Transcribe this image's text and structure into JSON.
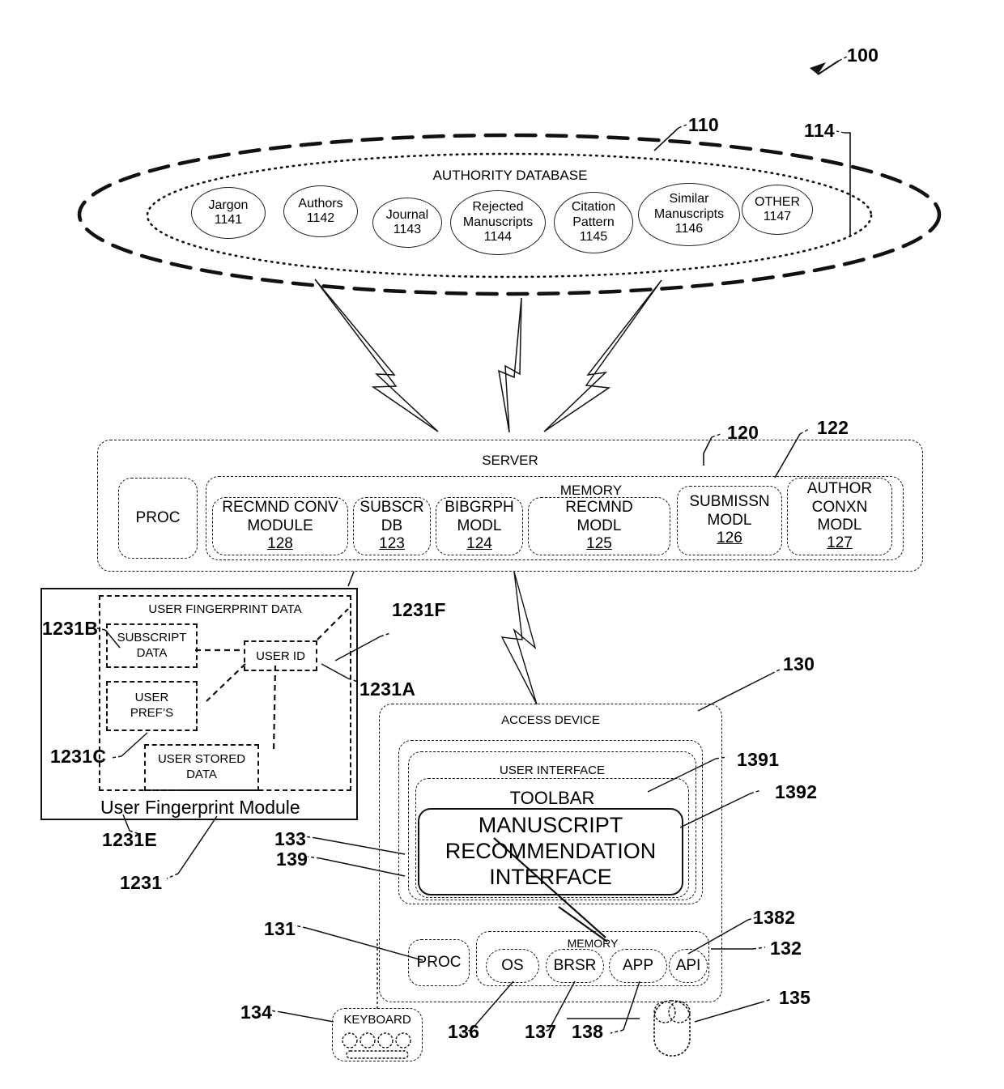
{
  "figure": {
    "system_ref": "100",
    "authority_database": {
      "title": "AUTHORITY DATABASE",
      "outer_ref": "110",
      "group_ref": "114",
      "nodes": [
        {
          "label": "Jargon",
          "ref": "1141"
        },
        {
          "label": "Authors",
          "ref": "1142"
        },
        {
          "label": "Journal",
          "ref": "1143"
        },
        {
          "label": "Rejected\nManuscripts",
          "ref": "1144"
        },
        {
          "label": "Citation\nPattern",
          "ref": "1145"
        },
        {
          "label": "Similar\nManuscripts",
          "ref": "1146"
        },
        {
          "label": "OTHER",
          "ref": "1147"
        }
      ]
    },
    "server": {
      "title": "SERVER",
      "ref": "120",
      "memory_label": "MEMORY",
      "memory_ref": "122",
      "proc_label": "PROC",
      "modules": [
        {
          "lines": [
            "RECMND CONV",
            "MODULE"
          ],
          "ref": "128"
        },
        {
          "lines": [
            "SUBSCR",
            "DB"
          ],
          "ref": "123"
        },
        {
          "lines": [
            "BIBGRPH",
            "MODL"
          ],
          "ref": "124"
        },
        {
          "lines": [
            "RECMND",
            "MODL"
          ],
          "ref": "125"
        },
        {
          "lines": [
            "SUBMISSN",
            "MODL"
          ],
          "ref": "126"
        },
        {
          "lines": [
            "AUTHOR",
            "CONXN",
            "MODL"
          ],
          "ref": "127"
        }
      ]
    },
    "fingerprint_module": {
      "module_title": "User Fingerprint Module",
      "module_ref": "1231",
      "data_title": "USER FINGERPRINT DATA",
      "data_ref": "1231E",
      "items": [
        {
          "lines": [
            "SUBSCRIPT",
            "DATA"
          ],
          "ref": "1231B"
        },
        {
          "lines": [
            "USER",
            "PREF’S"
          ],
          "ref": "1231C"
        },
        {
          "lines": [
            "USER STORED",
            "DATA"
          ],
          "ref": "1231A"
        },
        {
          "lines": [
            "USER ID"
          ],
          "ref": "1231F"
        }
      ]
    },
    "access_device": {
      "title": "ACCESS DEVICE",
      "ref": "130",
      "user_interface_label": "USER INTERFACE",
      "user_interface_ref": "1391",
      "toolbar_label": "TOOLBAR",
      "toolbar_ref": "1392",
      "interface_lines": [
        "MANUSCRIPT",
        "RECOMMENDATION",
        "INTERFACE"
      ],
      "interface_ref_a": "133",
      "interface_ref_b": "139",
      "proc_label": "PROC",
      "proc_ref": "131",
      "memory_label": "MEMORY",
      "memory_ref": "132",
      "api_ref": "1382",
      "apps": [
        {
          "label": "OS",
          "ref": "136"
        },
        {
          "label": "BRSR",
          "ref": "137"
        },
        {
          "label": "APP",
          "ref": "138"
        },
        {
          "label": "API",
          "ref": ""
        }
      ],
      "keyboard_label": "KEYBOARD",
      "keyboard_ref": "134",
      "mouse_ref": "135"
    }
  }
}
